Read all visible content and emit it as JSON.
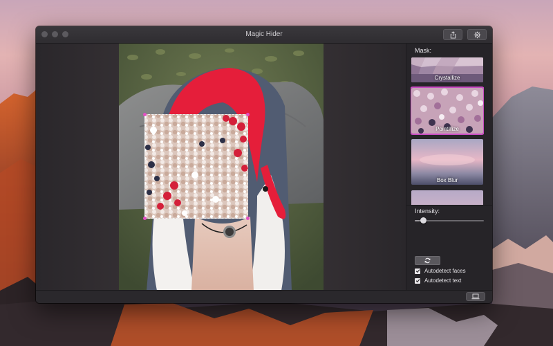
{
  "window": {
    "title": "Magic Hider",
    "share_icon": "share-icon",
    "settings_icon": "gear-icon"
  },
  "sidebar": {
    "mask_label": "Mask:",
    "masks": [
      {
        "label": "Crystallize",
        "selected": false
      },
      {
        "label": "Pointillize",
        "selected": true
      },
      {
        "label": "Box Blur",
        "selected": false
      },
      {
        "label": "",
        "selected": false
      }
    ],
    "intensity_label": "Intensity:",
    "intensity_value": 0.12,
    "refresh_icon": "refresh-icon",
    "checks": [
      {
        "label": "Autodetect faces",
        "checked": true
      },
      {
        "label": "Autodetect text",
        "checked": true
      }
    ]
  },
  "bottom": {
    "device_icon": "laptop-icon"
  },
  "colors": {
    "selection_handle": "#e34fc4",
    "selected_outline": "#c94bc2"
  }
}
